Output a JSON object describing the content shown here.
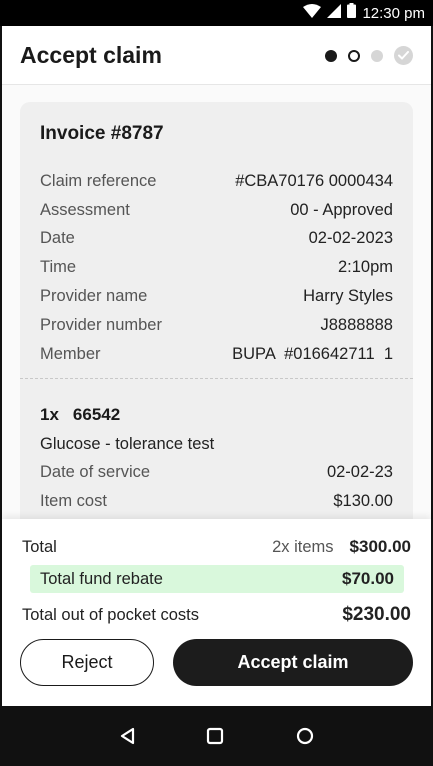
{
  "status_bar": {
    "time": "12:30 pm",
    "icons": [
      "wifi-icon",
      "signal-icon",
      "battery-icon"
    ]
  },
  "header": {
    "title": "Accept claim",
    "steps": [
      "complete",
      "current",
      "upcoming",
      "final-check"
    ]
  },
  "invoice": {
    "title": "Invoice #8787",
    "details": [
      {
        "label": "Claim reference",
        "value": "#CBA70176 0000434"
      },
      {
        "label": "Assessment",
        "value": "00 - Approved"
      },
      {
        "label": "Date",
        "value": "02-02-2023"
      },
      {
        "label": "Time",
        "value": "2:10pm"
      },
      {
        "label": "Provider name",
        "value": "Harry Styles"
      },
      {
        "label": "Provider number",
        "value": "J8888888"
      },
      {
        "label": "Member",
        "value": "BUPA  #016642711  1"
      }
    ],
    "item": {
      "quantity": "1x",
      "code": "66542",
      "name": "Glucose - tolerance test",
      "rows": [
        {
          "label": "Date of service",
          "value": "02-02-23"
        },
        {
          "label": "Item cost",
          "value": "$130.00"
        }
      ]
    }
  },
  "summary": {
    "total_label": "Total",
    "total_count": "2x items",
    "total_amount": "$300.00",
    "rebate_label": "Total fund rebate",
    "rebate_amount": "$70.00",
    "oop_label": "Total out of pocket costs",
    "oop_amount": "$230.00"
  },
  "actions": {
    "reject_label": "Reject",
    "accept_label": "Accept claim"
  },
  "colors": {
    "accent": "#1c1c1c",
    "rebate_highlight": "#d9f8dc",
    "card_bg": "#efefef"
  },
  "nav_bar": {
    "buttons": [
      "back-icon",
      "recents-icon",
      "home-icon"
    ]
  }
}
